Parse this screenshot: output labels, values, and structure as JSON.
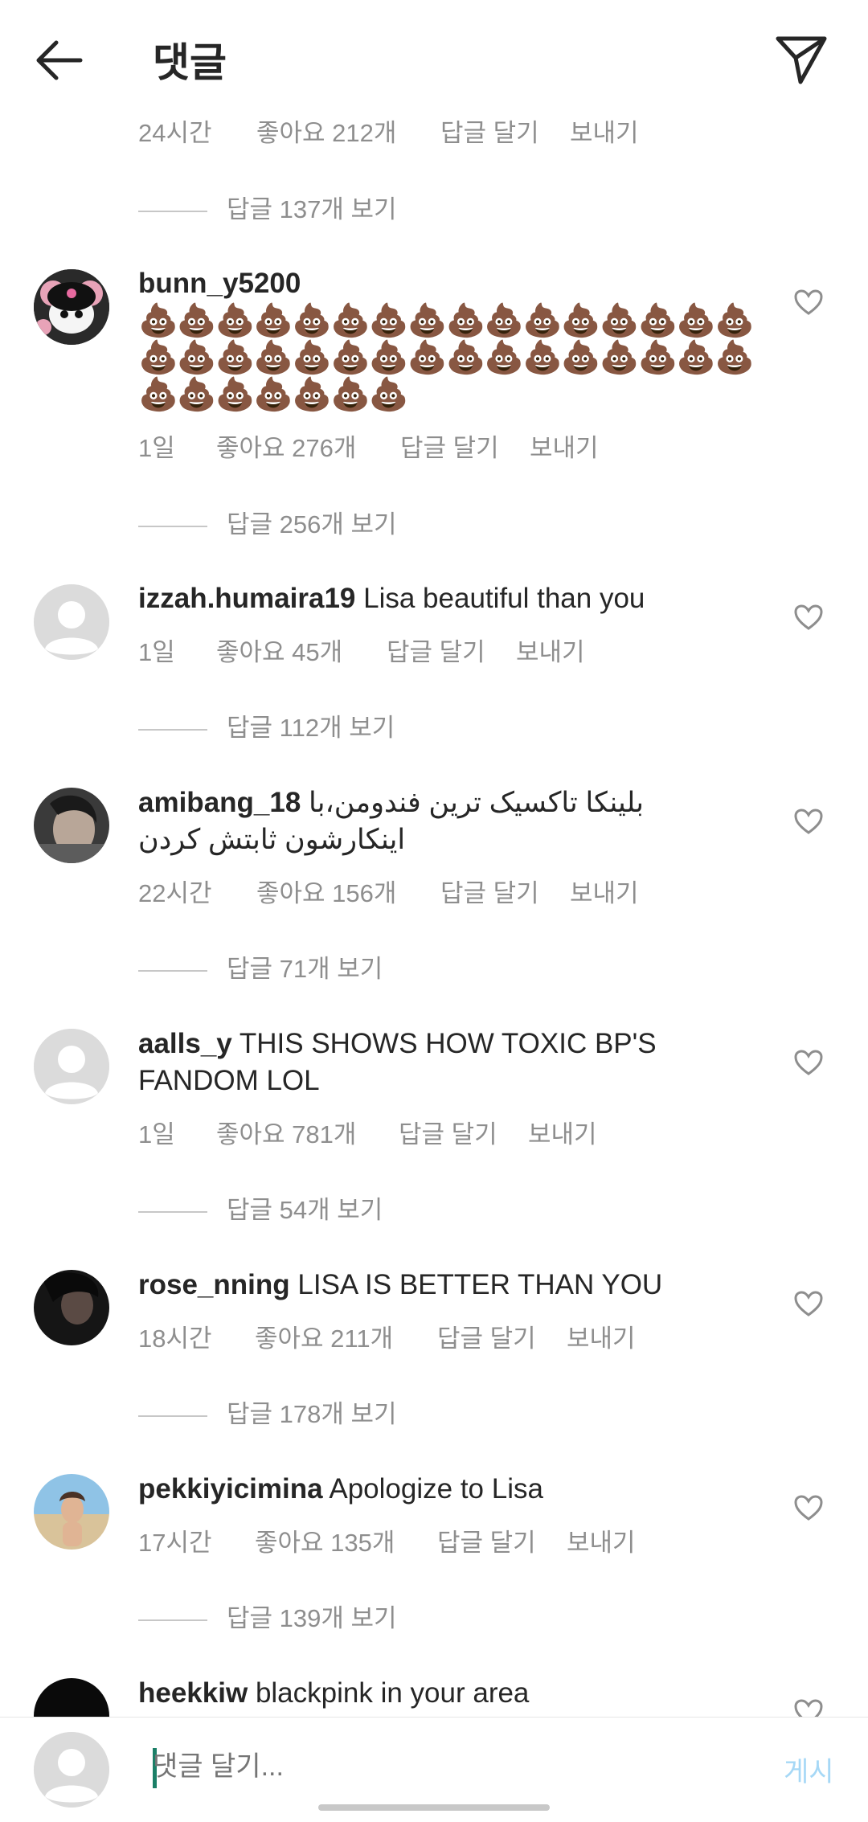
{
  "header": {
    "title": "댓글",
    "back_icon": "arrow-left-icon",
    "send_icon": "paper-plane-icon"
  },
  "top_meta": {
    "time": "24시간",
    "likes": "좋아요 212개",
    "reply": "답글 달기",
    "send": "보내기",
    "view_replies": "답글 137개 보기"
  },
  "comments": [
    {
      "user": "bunn_y5200",
      "text": "💩💩💩💩💩💩💩💩💩💩💩💩💩💩💩💩💩💩💩💩💩💩💩💩💩💩💩💩💩💩💩💩💩💩💩💩💩💩💩",
      "time": "1일",
      "likes": "좋아요 276개",
      "reply": "답글 달기",
      "send": "보내기",
      "view_replies": "답글 256개 보기"
    },
    {
      "user": "izzah.humaira19",
      "text": "Lisa beautiful than you",
      "time": "1일",
      "likes": "좋아요 45개",
      "reply": "답글 달기",
      "send": "보내기",
      "view_replies": "답글 112개 보기"
    },
    {
      "user": "amibang_18",
      "text": "بلینکا تاکسیک ترین فندومن،با اینکارشون ثابتش کردن",
      "time": "22시간",
      "likes": "좋아요 156개",
      "reply": "답글 달기",
      "send": "보내기",
      "view_replies": "답글 71개 보기"
    },
    {
      "user": "aalls_y",
      "text": "THIS SHOWS HOW TOXIC BP'S FANDOM LOL",
      "time": "1일",
      "likes": "좋아요 781개",
      "reply": "답글 달기",
      "send": "보내기",
      "view_replies": "답글 54개 보기"
    },
    {
      "user": "rose_nning",
      "text": "LISA IS BETTER THAN YOU",
      "time": "18시간",
      "likes": "좋아요 211개",
      "reply": "답글 달기",
      "send": "보내기",
      "view_replies": "답글 178개 보기"
    },
    {
      "user": "pekkiyicimina",
      "text": "Apologize to Lisa",
      "time": "17시간",
      "likes": "좋아요 135개",
      "reply": "답글 달기",
      "send": "보내기",
      "view_replies": "답글 139개 보기"
    },
    {
      "user": "heekkiw",
      "text": "blackpink in your area"
    }
  ],
  "input": {
    "placeholder": "댓글 달기...",
    "post_label": "게시"
  },
  "colors": {
    "text": "#262626",
    "muted": "#8e8e8e",
    "post": "#a6d8f6",
    "caret": "#1b7f67"
  }
}
